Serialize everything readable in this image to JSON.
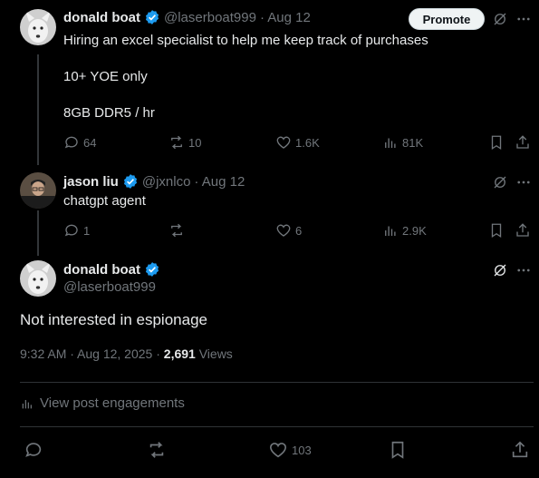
{
  "tweet1": {
    "name": "donald boat",
    "handle": "@laserboat999",
    "date": "· Aug 12",
    "promote_label": "Promote",
    "lines": [
      "Hiring an excel specialist to help me keep track of purchases",
      "10+ YOE only",
      "8GB DDR5 / hr"
    ],
    "replies": "64",
    "reposts": "10",
    "likes": "1.6K",
    "views": "81K"
  },
  "tweet2": {
    "name": "jason liu",
    "handle": "@jxnlco",
    "date": "· Aug 12",
    "text": "chatgpt agent",
    "replies": "1",
    "likes": "6",
    "views": "2.9K"
  },
  "main": {
    "name": "donald boat",
    "handle": "@laserboat999",
    "text": "Not interested in espionage",
    "timestamp": "9:32 AM · Aug 12, 2025 ·",
    "view_count": "2,691",
    "views_label": "Views",
    "engagements_label": "View post engagements",
    "likes": "103"
  },
  "colors": {
    "verified": "#1d9bf0",
    "muted": "#71767b",
    "text": "#e7e9ea"
  }
}
